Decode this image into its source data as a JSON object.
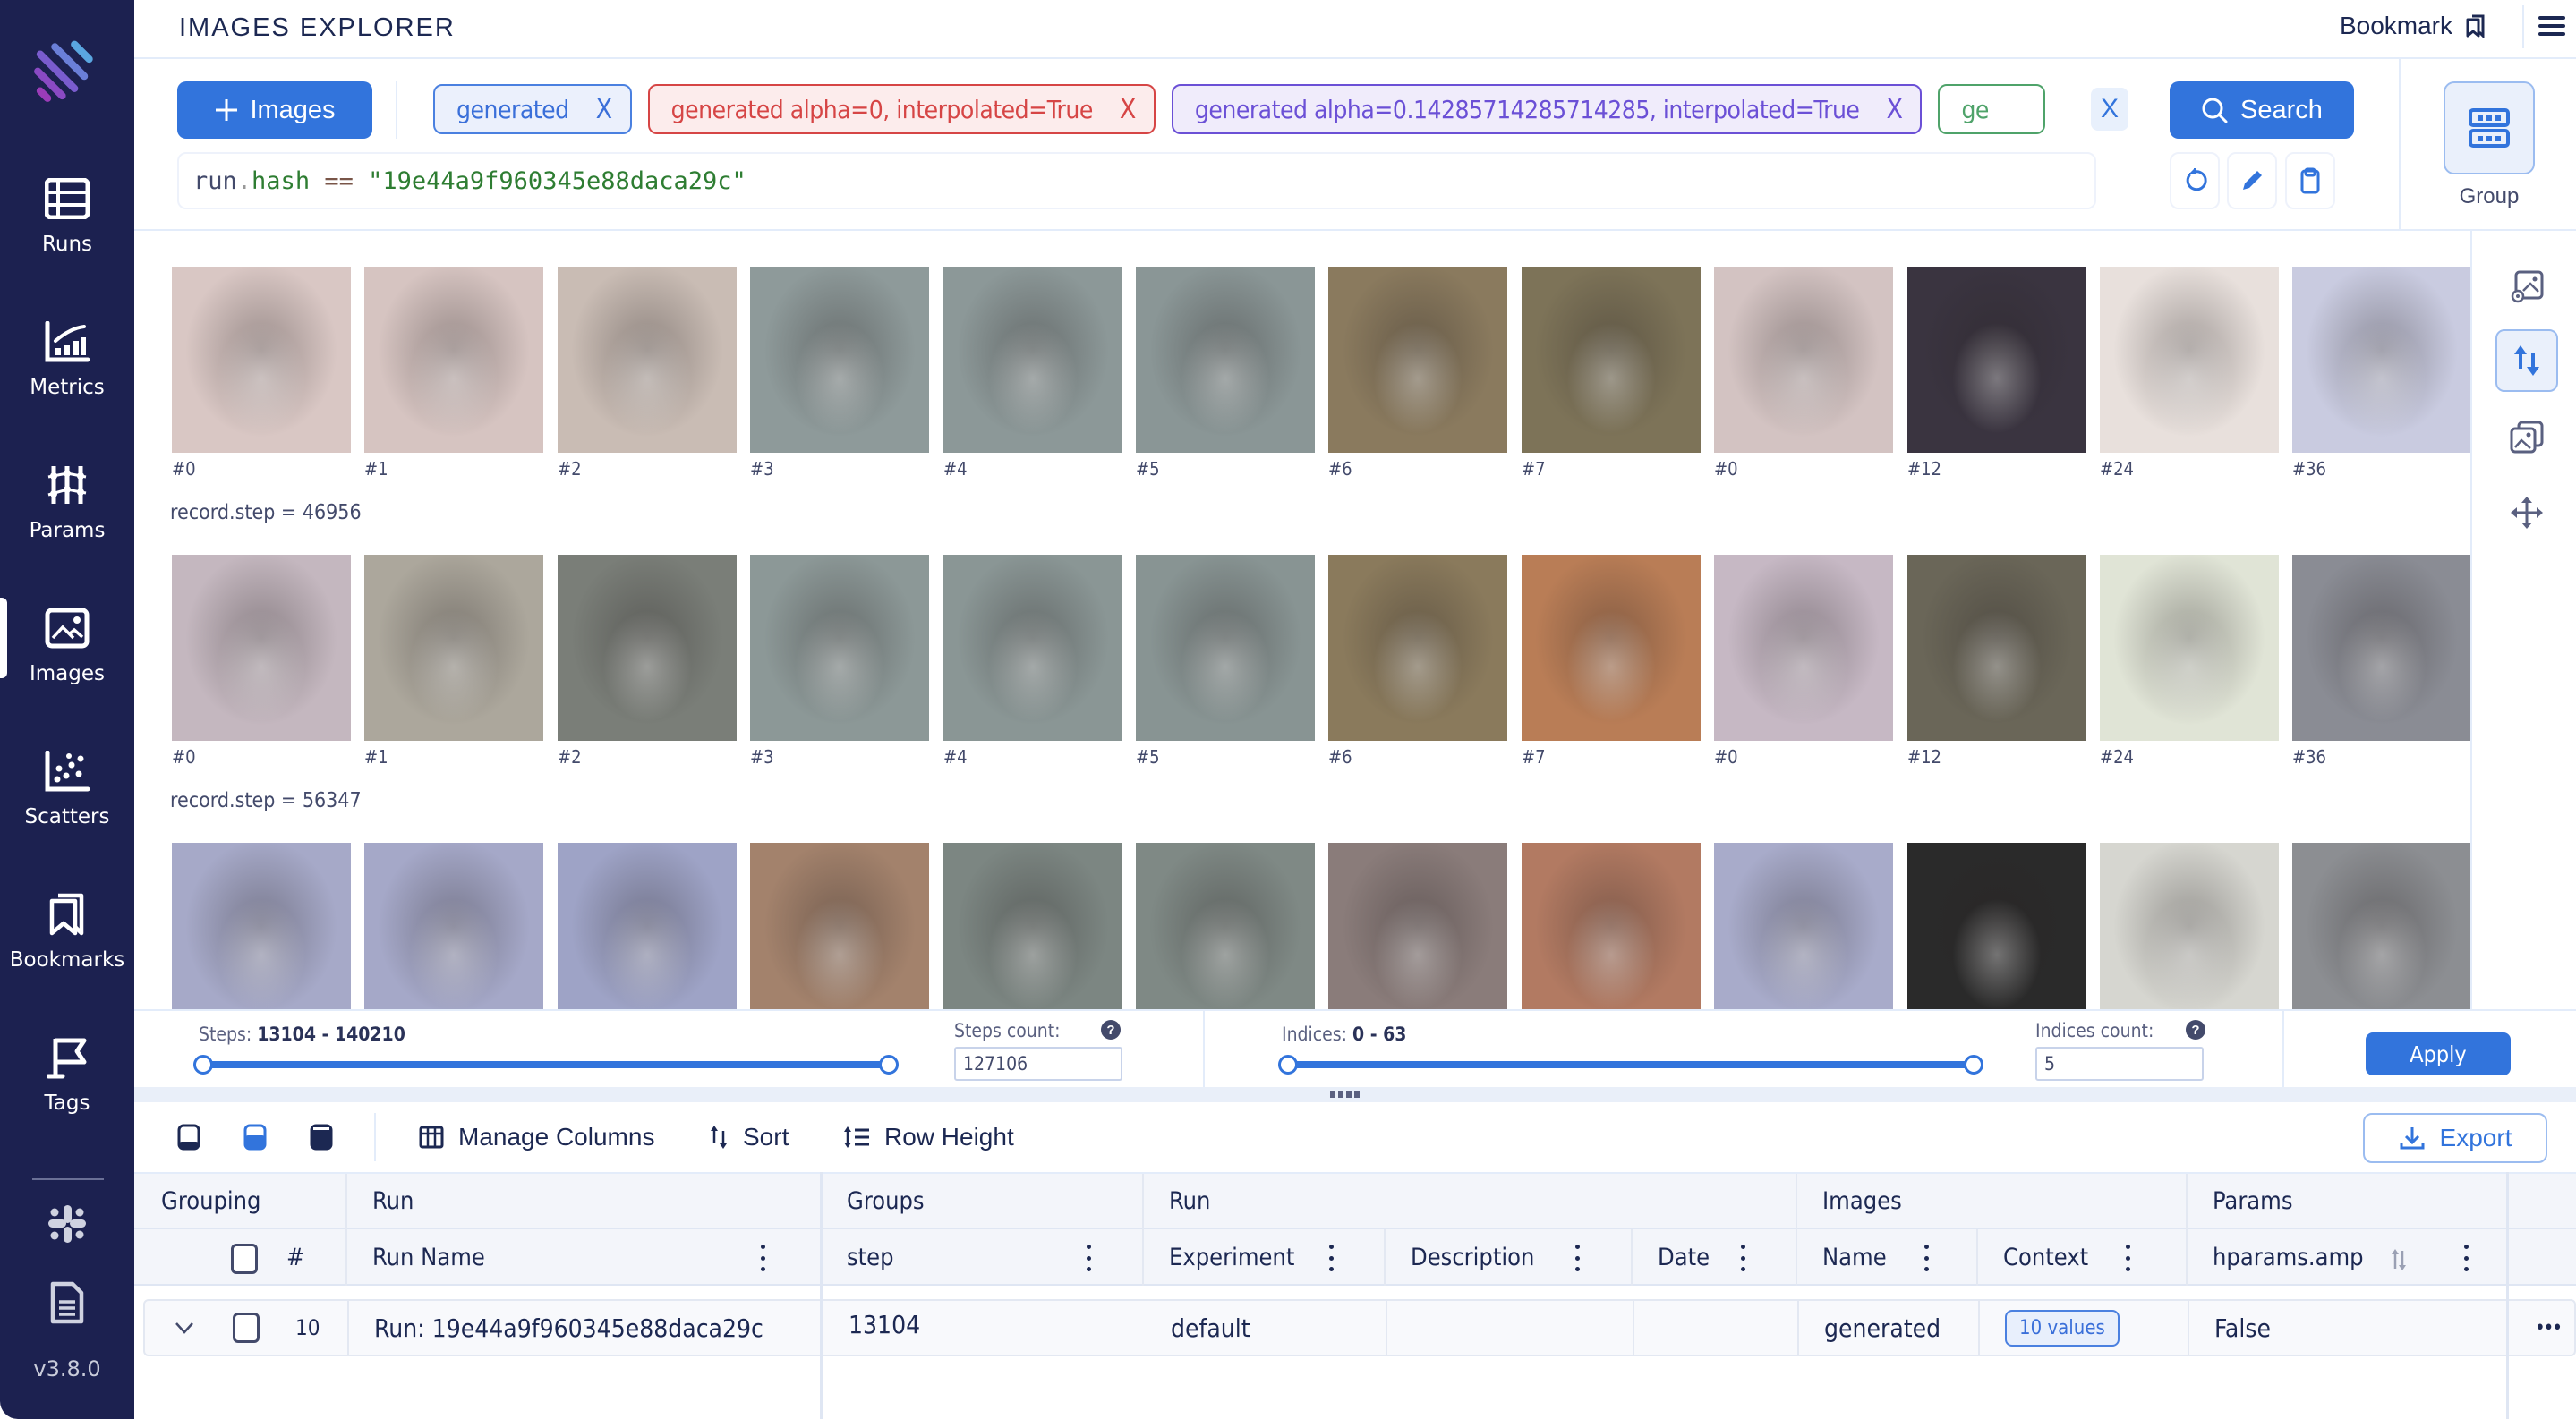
{
  "app": {
    "title": "IMAGES EXPLORER",
    "version": "v3.8.0"
  },
  "header": {
    "bookmark_label": "Bookmark"
  },
  "sidebar": {
    "items": [
      {
        "label": "Runs",
        "icon": "table-icon"
      },
      {
        "label": "Metrics",
        "icon": "chart-icon"
      },
      {
        "label": "Params",
        "icon": "params-icon"
      },
      {
        "label": "Images",
        "icon": "image-icon",
        "active": true
      },
      {
        "label": "Scatters",
        "icon": "scatter-icon"
      },
      {
        "label": "Bookmarks",
        "icon": "bookmark-icon"
      },
      {
        "label": "Tags",
        "icon": "flag-icon"
      }
    ],
    "bottom_icons": [
      "slack-icon",
      "docs-icon"
    ]
  },
  "controls": {
    "add_images_label": "Images",
    "search_label": "Search",
    "group_label": "Group",
    "query": {
      "var": "run",
      "dot": ".",
      "attr": "hash",
      "op": "==",
      "value": "\"19e44a9f960345e88daca29c\""
    },
    "chips": [
      {
        "label": "generated",
        "color": "blue"
      },
      {
        "label": "generated alpha=0, interpolated=True",
        "color": "red"
      },
      {
        "label": "generated alpha=0.14285714285714285, interpolated=True",
        "color": "purple"
      },
      {
        "label": "ge",
        "color": "green"
      }
    ],
    "close_glyph": "X"
  },
  "images": {
    "rows": [
      {
        "step_label": "",
        "labels": [
          "#0",
          "#1",
          "#2",
          "#3",
          "#4",
          "#5",
          "#6",
          "#7",
          "#0",
          "#12",
          "#24",
          "#36"
        ]
      },
      {
        "step_label": "record.step = 46956",
        "labels": [
          "#0",
          "#1",
          "#2",
          "#3",
          "#4",
          "#5",
          "#6",
          "#7",
          "#0",
          "#12",
          "#24",
          "#36"
        ]
      },
      {
        "step_label": "record.step = 56347",
        "labels": []
      }
    ],
    "tile_colors": [
      [
        "#d9c7c4",
        "#d6c4c1",
        "#c9bcb4",
        "#8e9a9a",
        "#8c9898",
        "#8a9696",
        "#8a7a5e",
        "#7d7358",
        "#d3c3c2",
        "#3a3440",
        "#e8e0dc",
        "#c9cbe0"
      ],
      [
        "#c4b7bf",
        "#aca79c",
        "#7a7e78",
        "#8c9897",
        "#8a9695",
        "#889493",
        "#8a7a5c",
        "#b97d56",
        "#c6b8c4",
        "#6a6658",
        "#e0e4d6",
        "#8a8c94"
      ],
      [
        "#a6a9c8",
        "#a5a8c8",
        "#9ea3c6",
        "#a3826c",
        "#7c8682",
        "#7f8985",
        "#8a7c7a",
        "#b27a62",
        "#a8abca",
        "#2a2a2a",
        "#d6d6d0",
        "#8c8e92"
      ]
    ],
    "right_tools": [
      "image-settings-icon",
      "sort-arrows-icon",
      "image-stack-icon",
      "move-icon"
    ]
  },
  "sliders": {
    "steps": {
      "label": "Steps:",
      "range": "13104 - 140210",
      "min": 13104,
      "max": 140210,
      "low": 13104,
      "high": 140210
    },
    "steps_count": {
      "label": "Steps count:",
      "value": "127106"
    },
    "indices": {
      "label": "Indices:",
      "range": "0 - 63",
      "min": 0,
      "max": 63,
      "low": 0,
      "high": 63
    },
    "indices_count": {
      "label": "Indices count:",
      "value": "5"
    },
    "help_glyph": "?",
    "apply_label": "Apply"
  },
  "table_toolbar": {
    "manage_columns": "Manage Columns",
    "sort": "Sort",
    "row_height": "Row Height",
    "export": "Export"
  },
  "table": {
    "group_headers": [
      "Grouping",
      "Run",
      "Groups",
      "Run",
      "Images",
      "Params"
    ],
    "columns": {
      "index": "#",
      "run_name": "Run Name",
      "step": "step",
      "experiment": "Experiment",
      "description": "Description",
      "date": "Date",
      "name": "Name",
      "context": "Context",
      "hparams": "hparams.amp"
    },
    "rows": [
      {
        "index": "10",
        "run_name": "Run: 19e44a9f960345e88daca29c",
        "step": "13104",
        "experiment": "default",
        "description": "",
        "date": "",
        "name": "generated",
        "context": "10 values",
        "hparams": "False"
      }
    ],
    "row_more_glyph": "•••"
  }
}
